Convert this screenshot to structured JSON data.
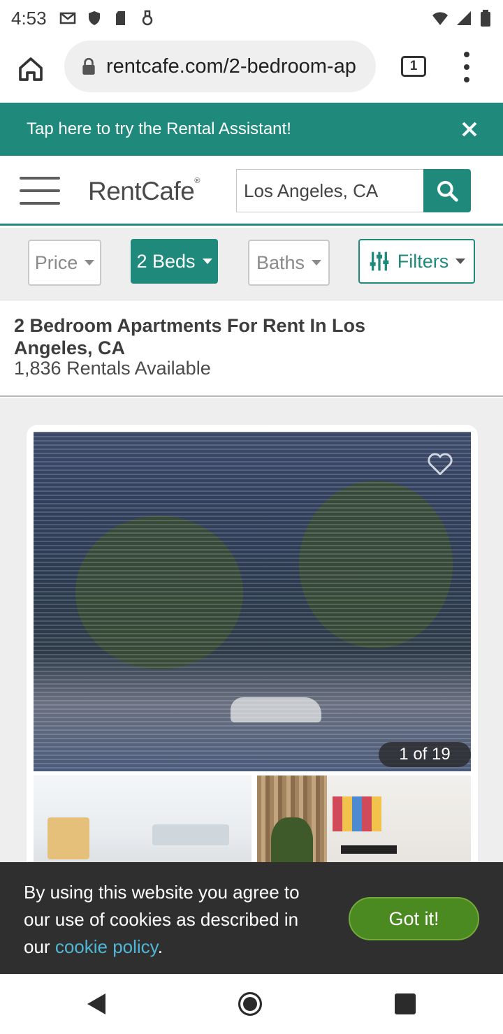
{
  "status_bar": {
    "time": "4:53"
  },
  "browser": {
    "url": "rentcafe.com/2-bedroom-ap",
    "tab_count": "1"
  },
  "banner": {
    "text": "Tap here to try the Rental Assistant!"
  },
  "header": {
    "logo": "RentCafe",
    "search_value": "Los Angeles, CA"
  },
  "filters": {
    "price": "Price",
    "beds": "2 Beds",
    "baths": "Baths",
    "more": "Filters"
  },
  "results": {
    "title": "2 Bedroom Apartments For Rent In Los Angeles, CA",
    "count": "1,836 Rentals Available"
  },
  "listing": {
    "photo_counter": "1 of 19"
  },
  "cookie": {
    "text_before": "By using this website you agree to our use of cookies as described in our ",
    "link": "cookie policy",
    "text_after": ".",
    "button": "Got it!"
  },
  "colors": {
    "brand_teal": "#1f8a7c",
    "cookie_button": "#4a8a21",
    "cookie_link": "#4fb6d6"
  },
  "icons": [
    "gmail-icon",
    "shield-icon",
    "sd-card-icon",
    "usb-icon",
    "wifi-icon",
    "signal-icon",
    "battery-icon",
    "home-icon",
    "lock-icon",
    "overflow-menu-icon",
    "close-icon",
    "hamburger-icon",
    "search-icon",
    "sliders-icon",
    "favorite-icon",
    "back-icon",
    "home-nav-icon",
    "recents-icon"
  ]
}
